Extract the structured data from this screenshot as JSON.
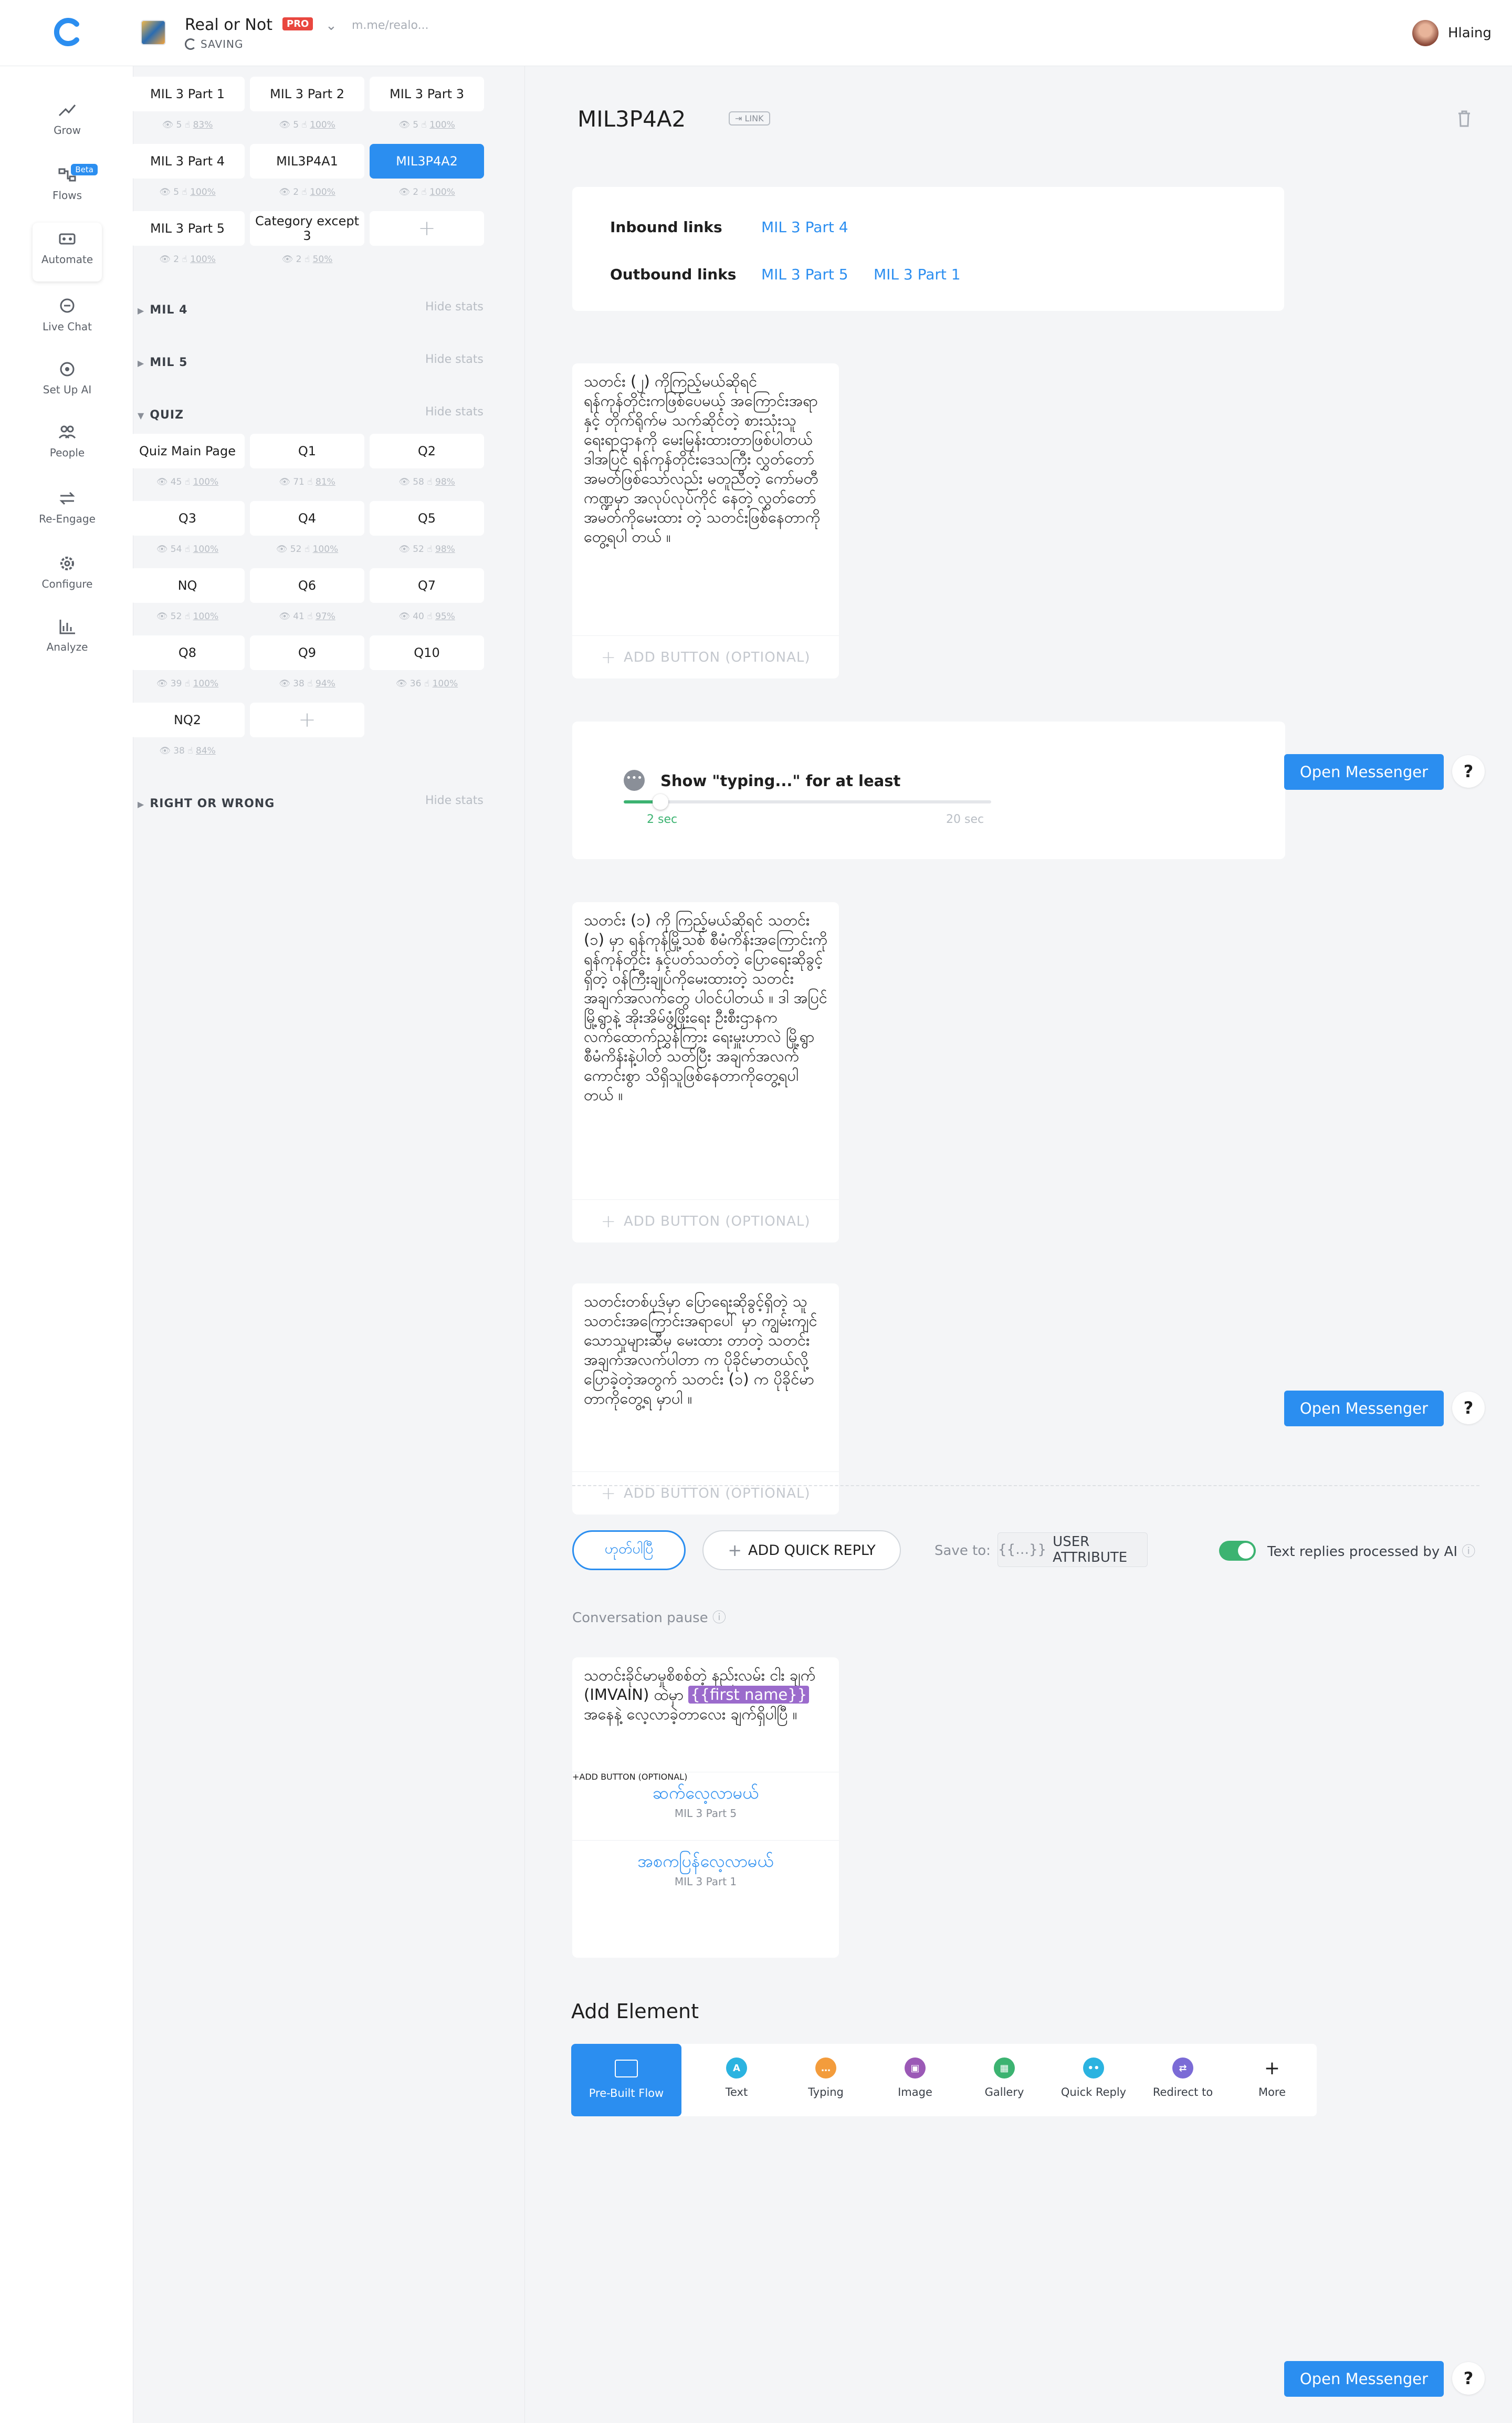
{
  "header": {
    "bot_name": "Real or Not",
    "plan": "PRO",
    "url": "m.me/realo...",
    "status": "SAVING",
    "user": "Hlaing"
  },
  "nav": [
    {
      "label": "Grow"
    },
    {
      "label": "Flows",
      "badge": "Beta"
    },
    {
      "label": "Automate"
    },
    {
      "label": "Live Chat"
    },
    {
      "label": "Set Up AI"
    },
    {
      "label": "People"
    },
    {
      "label": "Re-Engage"
    },
    {
      "label": "Configure"
    },
    {
      "label": "Analyze"
    }
  ],
  "tree": {
    "top_cells": [
      {
        "label": "MIL 3 Part 1",
        "sent": "5",
        "ctr": "83%"
      },
      {
        "label": "MIL 3 Part 2",
        "sent": "5",
        "ctr": "100%"
      },
      {
        "label": "MIL 3 Part 3",
        "sent": "5",
        "ctr": "100%"
      },
      {
        "label": "MIL 3 Part 4",
        "sent": "5",
        "ctr": "100%"
      },
      {
        "label": "MIL3P4A1",
        "sent": "2",
        "ctr": "100%"
      },
      {
        "label": "MIL3P4A2",
        "sent": "2",
        "ctr": "100%"
      },
      {
        "label": "MIL 3 Part 5",
        "sent": "2",
        "ctr": "100%"
      },
      {
        "label": "Category except 3",
        "sent": "2",
        "ctr": "50%"
      }
    ],
    "hide_stats": "Hide stats",
    "sections": [
      "MIL 4",
      "MIL 5",
      "QUIZ",
      "RIGHT OR WRONG"
    ],
    "quiz_cells": [
      {
        "label": "Quiz Main Page",
        "sent": "45",
        "ctr": "100%"
      },
      {
        "label": "Q1",
        "sent": "71",
        "ctr": "81%"
      },
      {
        "label": "Q2",
        "sent": "58",
        "ctr": "98%"
      },
      {
        "label": "Q3",
        "sent": "54",
        "ctr": "100%"
      },
      {
        "label": "Q4",
        "sent": "52",
        "ctr": "100%"
      },
      {
        "label": "Q5",
        "sent": "52",
        "ctr": "98%"
      },
      {
        "label": "NQ",
        "sent": "52",
        "ctr": "100%"
      },
      {
        "label": "Q6",
        "sent": "41",
        "ctr": "97%"
      },
      {
        "label": "Q7",
        "sent": "40",
        "ctr": "95%"
      },
      {
        "label": "Q8",
        "sent": "39",
        "ctr": "100%"
      },
      {
        "label": "Q9",
        "sent": "38",
        "ctr": "94%"
      },
      {
        "label": "Q10",
        "sent": "36",
        "ctr": "100%"
      },
      {
        "label": "NQ2",
        "sent": "38",
        "ctr": "84%"
      }
    ]
  },
  "main": {
    "title": "MIL3P4A2",
    "link_badge": "LINK",
    "inbound_label": "Inbound links",
    "inbound": [
      "MIL 3 Part 4"
    ],
    "outbound_label": "Outbound links",
    "outbound": [
      "MIL 3 Part 5",
      "MIL 3 Part 1"
    ],
    "card1": "သတင်း (၂) ကိုကြည့်မယ်ဆိုရင် ရန်ကုန်တိုင်းကဖြစ်ပေမယ့် အကြောင်းအရာနှင့် တိုက်ရိုက်မ သက်ဆိုင်တဲ့ စားသုံးသူရေးရာဌာနကို မေးမြန်းထားတာဖြစ်ပါတယ် ဒါအပြင် ရန်ကုန်တိုင်းဒေသကြီး လွှတ်တော် အမတ်ဖြစ်သော်လည်း မတူညီတဲ့ ကော်မတီ ကဏ္ဍမှာ အလုပ်လုပ်ကိုင် နေတဲ့ လွှတ်တော် အမတ်ကိုမေးထား တဲ့ သတင်းဖြစ်နေတာကိုတွေ့ရပါ တယ် ။",
    "add_button": "ADD BUTTON (OPTIONAL)",
    "typing_label": "Show \"typing...\" for at least",
    "typing_value": "2 sec",
    "typing_max": "20 sec",
    "typing_fraction": 0.1,
    "open_messenger": "Open Messenger",
    "help": "?",
    "card2": "သတင်း (၁) ကို ကြည့်မယ်ဆိုရင် သတင်း (၁) မှာ ရန်ကုန်မြို့သစ် စီမံကိန်းအကြောင်းကို ရန်ကုန်တိုင်း နှင့်ပတ်သတ်တဲ့ ပြောရေးဆိုခွင့်ရှိတဲ့ ဝန်ကြီးချုပ်ကိုမေးထားတဲ့ သတင်း အချက်အလက်တွေ ပါဝင်ပါတယ် ။ ဒါ အပြင် မြို့ရွာနဲ့ အိုးအိမ်ဖွံ့ဖြိုးရေး ဦးစီးဌာနက လက်ထောက်ညွှန်ကြား ရေးမှူးဟာလဲ မြို့ရွာစီမံကိန်းနဲ့ပါတ် သတ်ပြီး အချက်အလက်ကောင်းစွာ သိရှိသူဖြစ်နေတာကိုတွေ့ရပါတယ် ။",
    "card3": "သတင်းတစ်ပုဒ်မှာ ပြောရေးဆိုခွင့်ရှိတဲ့ သူ သတင်းအကြောင်းအရာပေါ် မှာ ကျွမ်းကျင်သောသူများဆီမှ မေးထား တာတဲ့ သတင်းအချက်အလက်ပါတာ က ပိုခိုင်မာတယ်လို့ ပြောခဲ့တဲ့အတွက် သတင်း (၁) က ပိုခိုင်မာတာကိုတွေ့ရ မှာပါ ။",
    "qr_done": "ဟုတ်ပါပြီ",
    "add_quick_reply": "ADD QUICK REPLY",
    "save_to": "Save to:",
    "user_attribute": "USER ATTRIBUTE",
    "text_replies": "Text replies processed by AI",
    "conversation_pause": "Conversation pause",
    "qr_text_a": "သတင်းခိုင်မာမှုစိစစ်တဲ့ နည်းလမ်း ငါး ချက် (IMVAIN) ထဲမှာ ",
    "qr_attr": "{{first name}}",
    "qr_text_b": " အနေနဲ့ လေ့လာခဲ့တာလေး ချက်ရှိပါပြီ ။",
    "qr_options": [
      {
        "title": "ဆက်လေ့လာမယ်",
        "target": "MIL 3 Part 5"
      },
      {
        "title": "အစကပြန်လေ့လာမယ်",
        "target": "MIL 3 Part 1"
      }
    ],
    "add_element": "Add Element",
    "tools": [
      {
        "label": "Pre-Built Flow"
      },
      {
        "label": "Text",
        "color": "#2bb3e0",
        "glyph": "A"
      },
      {
        "label": "Typing",
        "color": "#f39c3c",
        "glyph": "…"
      },
      {
        "label": "Image",
        "color": "#9b59b6",
        "glyph": "▣"
      },
      {
        "label": "Gallery",
        "color": "#3cb371",
        "glyph": "▦"
      },
      {
        "label": "Quick Reply",
        "color": "#2bb3e0",
        "glyph": "••"
      },
      {
        "label": "Redirect to",
        "color": "#7b6bd6",
        "glyph": "⇄"
      },
      {
        "label": "More",
        "glyph": "+"
      }
    ]
  }
}
